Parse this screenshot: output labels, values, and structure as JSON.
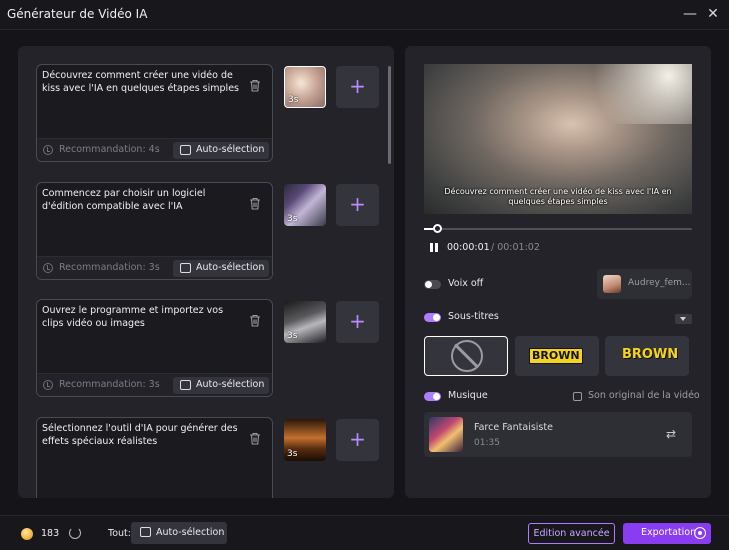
{
  "window": {
    "title": "Générateur de Vidéo IA",
    "minimize_icon": "minimize-icon",
    "close_icon": "close-icon"
  },
  "scenes": [
    {
      "text": "Découvrez comment créer une vidéo de kiss avec l'IA en quelques étapes simples",
      "recommendation": "Recommandation: 4s",
      "auto_label": "Auto-sélection",
      "duration": "3s",
      "selected": true
    },
    {
      "text": "Commencez par choisir un logiciel d'édition compatible avec l'IA",
      "recommendation": "Recommandation: 3s",
      "auto_label": "Auto-sélection",
      "duration": "3s",
      "selected": false
    },
    {
      "text": "Ouvrez le programme et importez vos clips vidéo ou images",
      "recommendation": "Recommandation: 3s",
      "auto_label": "Auto-sélection",
      "duration": "3s",
      "selected": false
    },
    {
      "text": "Sélectionnez l'outil d'IA pour générer des effets spéciaux réalistes",
      "recommendation": "",
      "auto_label": "",
      "duration": "3s",
      "selected": false
    }
  ],
  "preview": {
    "subtitle": "Découvrez comment créer une vidéo de kiss avec l'IA en quelques étapes simples",
    "current_time": "00:00:01",
    "total_time": "/ 00:01:02",
    "progress": 0.05
  },
  "voice": {
    "label": "Voix off",
    "enabled": false,
    "voice_name": "Audrey_fem..."
  },
  "subtitles": {
    "label": "Sous-titres",
    "enabled": true,
    "styles": [
      {
        "name": "none"
      },
      {
        "name": "BROWN"
      },
      {
        "name": "BROWN"
      }
    ]
  },
  "music": {
    "label": "Musique",
    "enabled": true,
    "original_audio_label": "Son original de la vidéo",
    "track_title": "Farce Fantaisiste",
    "track_duration": "01:35"
  },
  "bottom": {
    "credits": "183",
    "all_label": "Tout:",
    "auto_label": "Auto-sélection",
    "advanced_label": "Edition avancée",
    "export_label": "Exportation"
  },
  "colors": {
    "accent": "#8a3cf0",
    "toggle_on": "#b07cff",
    "brown_style": "#f4d31c"
  }
}
